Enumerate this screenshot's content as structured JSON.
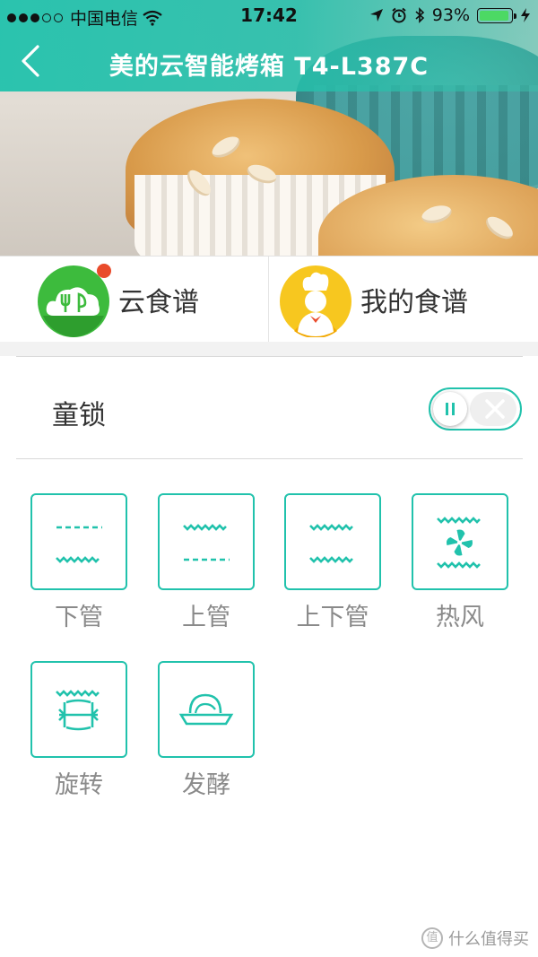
{
  "status_bar": {
    "carrier": "中国电信",
    "time": "17:42",
    "battery": "93%",
    "battery_level": 0.93
  },
  "header": {
    "title": "美的云智能烤箱 T4-L387C",
    "back_icon": "chevron-left-icon"
  },
  "tabs": [
    {
      "label": "云食谱",
      "icon": "cloud-recipe-icon",
      "color": "#3dbb3d",
      "has_badge": true
    },
    {
      "label": "我的食谱",
      "icon": "chef-icon",
      "color": "#f7c71f",
      "has_badge": false
    }
  ],
  "child_lock": {
    "label": "童锁",
    "enabled": false
  },
  "modes": [
    {
      "label": "下管",
      "icon": "bottom-heater-icon"
    },
    {
      "label": "上管",
      "icon": "top-heater-icon"
    },
    {
      "label": "上下管",
      "icon": "top-bottom-heater-icon"
    },
    {
      "label": "热风",
      "icon": "convection-fan-icon"
    },
    {
      "label": "旋转",
      "icon": "rotisserie-icon"
    },
    {
      "label": "发酵",
      "icon": "proofing-icon"
    }
  ],
  "watermark": {
    "glyph": "值",
    "text": "什么值得买"
  },
  "colors": {
    "accent": "#21c2ac",
    "badge": "#e94b2b",
    "label_gray": "#8a8a8a"
  }
}
